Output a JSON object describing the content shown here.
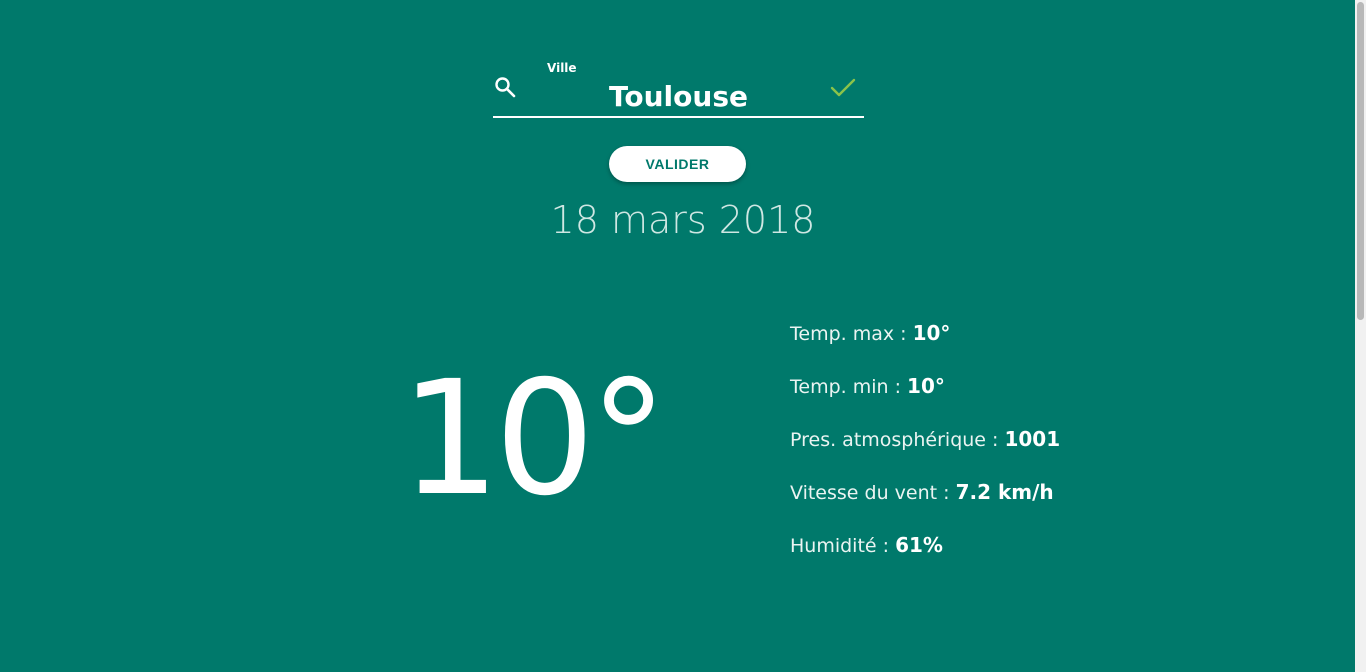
{
  "search": {
    "label": "Ville",
    "value": "Toulouse",
    "icon": "search-icon",
    "valid_icon": "check-icon",
    "valid_color": "#8bc34a"
  },
  "actions": {
    "validate_label": "VALIDER"
  },
  "weather": {
    "date": "18 mars 2018",
    "temperature": "10°",
    "details": [
      {
        "label": "Temp. max : ",
        "value": "10°"
      },
      {
        "label": "Temp. min : ",
        "value": "10°"
      },
      {
        "label": "Pres. atmosphérique : ",
        "value": "1001"
      },
      {
        "label": "Vitesse du vent : ",
        "value": "7.2 km/h"
      },
      {
        "label": "Humidité : ",
        "value": "61%"
      }
    ]
  },
  "theme": {
    "background": "#00796b",
    "button_background": "#ffffff",
    "button_text": "#00796b"
  }
}
